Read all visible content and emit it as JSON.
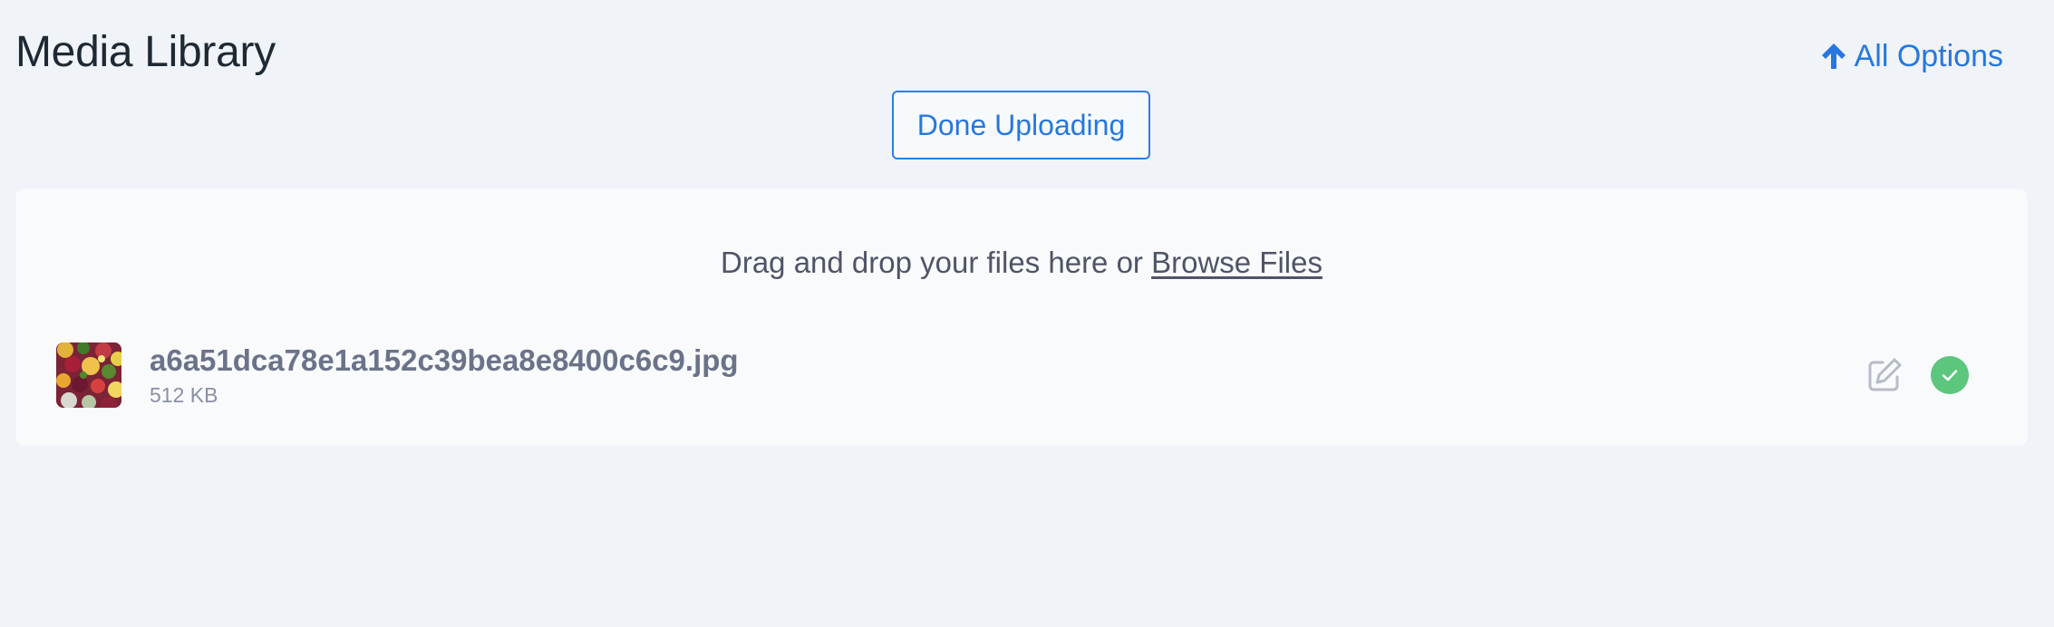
{
  "header": {
    "title": "Media Library",
    "all_options_label": "All Options",
    "all_options_icon": "arrow-up-icon"
  },
  "toolbar": {
    "done_label": "Done Uploading"
  },
  "dropzone": {
    "prompt": "Drag and drop your files here or",
    "browse_label": "Browse Files"
  },
  "files": [
    {
      "name": "a6a51dca78e1a152c39bea8e8400c6c9.jpg",
      "size": "512 KB",
      "status": "uploaded",
      "thumbnail_icon": "image-thumbnail-icon",
      "edit_icon": "edit-icon",
      "status_icon": "check-circle-icon"
    }
  ],
  "colors": {
    "background": "#f0f4f8",
    "panel": "#f8fafc",
    "accent": "#2677e0",
    "success": "#5cc67c",
    "title_text": "#1e2933",
    "muted_text": "#6b7389"
  }
}
